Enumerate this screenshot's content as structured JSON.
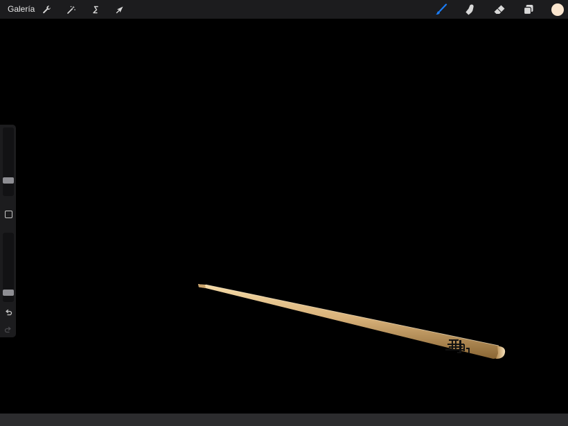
{
  "toolbar": {
    "gallery_label": "Galería",
    "actions_icon": "wrench-icon",
    "adjustments_icon": "magic-wand-icon",
    "selection_icon": "selection-s-icon",
    "transform_icon": "arrow-cursor-icon",
    "brush_icon": "brush-icon",
    "smudge_icon": "smudge-finger-icon",
    "eraser_icon": "eraser-icon",
    "layers_icon": "layers-icon",
    "current_color": "#fbe6cf"
  },
  "sidebar": {
    "brush_size_level": 0.2,
    "opacity_level": 0.1,
    "modify_icon": "square-icon",
    "undo_icon": "undo-icon",
    "redo_icon": "redo-icon"
  },
  "colors": {
    "accent": "#1a7cf5",
    "topbar_bg": "#1c1c1e",
    "canvas_bg": "#000000",
    "chopstick": "#d9b27a"
  }
}
